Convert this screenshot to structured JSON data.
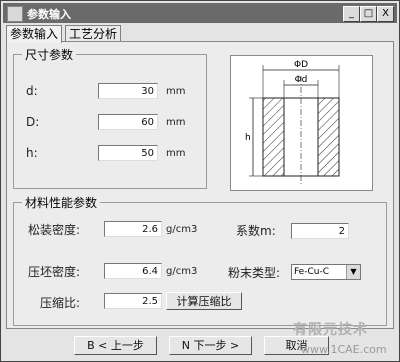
{
  "window": {
    "title": "参数输入"
  },
  "window_buttons": {
    "minimize": "_",
    "maximize": "□",
    "close": "X"
  },
  "tabs": [
    {
      "label": "参数输入"
    },
    {
      "label": "工艺分析"
    }
  ],
  "dimensions": {
    "title": "尺寸参数",
    "rows": [
      {
        "label": "d:",
        "value": "30",
        "unit": "mm"
      },
      {
        "label": "D:",
        "value": "60",
        "unit": "mm"
      },
      {
        "label": "h:",
        "value": "50",
        "unit": "mm"
      }
    ]
  },
  "drawing": {
    "outer_label": "ΦD",
    "inner_label": "Φd",
    "height_label": "h"
  },
  "material": {
    "title": "材料性能参数",
    "loose_density": {
      "label": "松装密度:",
      "value": "2.6",
      "unit": "g/cm3"
    },
    "coefficient": {
      "label": "系数m:",
      "value": "2"
    },
    "compact_density": {
      "label": "压坯密度:",
      "value": "6.4",
      "unit": "g/cm3"
    },
    "powder_type": {
      "label": "粉末类型:",
      "selected": "Fe-Cu-C"
    },
    "compression_ratio": {
      "label": "压缩比:",
      "value": "2.5"
    },
    "calc_button": "计算压缩比"
  },
  "footer": {
    "prev": "B < 上一步",
    "next": "N 下一步 >",
    "cancel": "取消"
  },
  "watermark": {
    "text": "有限元技术",
    "site": "www.1CAE.com"
  }
}
